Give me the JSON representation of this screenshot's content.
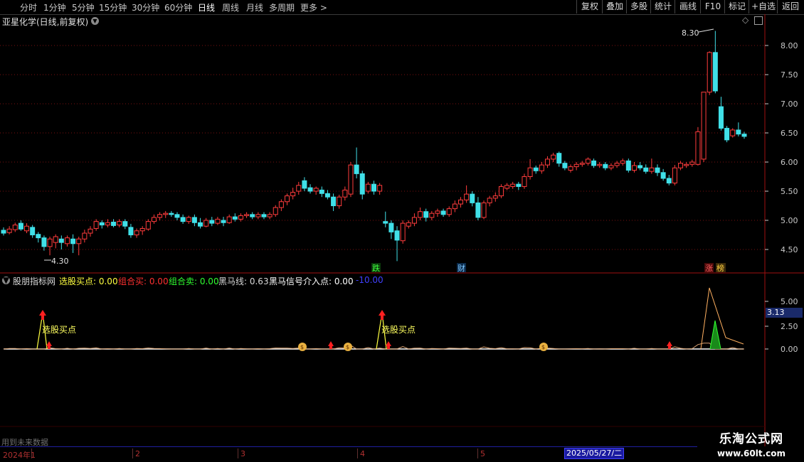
{
  "toolbar": {
    "periods": [
      "分时",
      "1分钟",
      "5分钟",
      "15分钟",
      "30分钟",
      "60分钟",
      "日线",
      "周线",
      "月线",
      "多周期",
      "更多 >"
    ],
    "active_period": "日线",
    "buttons": [
      "复权",
      "叠加",
      "多股",
      "统计",
      "画线",
      "F10",
      "标记",
      "+自选",
      "返回"
    ]
  },
  "chart_title": "亚星化学(日线,前复权)",
  "price_axis": {
    "ticks": [
      "8.00",
      "7.50",
      "7.00",
      "6.50",
      "6.00",
      "5.50",
      "5.00",
      "4.50"
    ]
  },
  "markers": {
    "high": "8.30",
    "low": "4.30"
  },
  "event_tags": [
    "跌",
    "财",
    "涨",
    "榜"
  ],
  "indicator": {
    "name": "股朋指标网",
    "items": [
      {
        "label": "选股买点: 0.00",
        "color": "#ffff40"
      },
      {
        "label": "组合买: 0.00",
        "color": "#ff3030"
      },
      {
        "label": "组合卖: 0.00",
        "color": "#30ff30"
      },
      {
        "label": "黑马线: 0.63",
        "color": "#d8d8d8"
      },
      {
        "label": "黑马信号介入点: 0.00",
        "color": "#ffffff"
      },
      {
        "label": "-10.00",
        "color": "#4040ff"
      }
    ],
    "axis_ticks": [
      "5.00",
      "2.50",
      "0.00"
    ],
    "current_value": "3.13",
    "signal_label": "选股买点"
  },
  "bottom_note": "用到未来数据",
  "timeline": {
    "labels": [
      "2024年1",
      "2",
      "3",
      "4",
      "5"
    ],
    "cursor_date": "2025/05/27/二"
  },
  "watermark": {
    "line1": "乐淘公式网",
    "line2": "www.60lt.com"
  },
  "colors": {
    "up": "#ff3c3c",
    "down": "#40e0e8",
    "grid": "#7a1010",
    "axis_text": "#c8c8c8"
  },
  "chart_data": {
    "type": "candlestick",
    "title": "亚星化学(日线,前复权)",
    "ylim": [
      4.2,
      8.3
    ],
    "y_ticks": [
      8.0,
      7.5,
      7.0,
      6.5,
      6.0,
      5.5,
      5.0,
      4.5
    ],
    "candles": [
      [
        4.83,
        4.78,
        4.88,
        4.74
      ],
      [
        4.79,
        4.85,
        4.9,
        4.76
      ],
      [
        4.84,
        4.92,
        4.96,
        4.8
      ],
      [
        4.95,
        4.85,
        5.0,
        4.82
      ],
      [
        4.82,
        4.9,
        4.95,
        4.78
      ],
      [
        4.88,
        4.75,
        4.92,
        4.7
      ],
      [
        4.76,
        4.7,
        4.8,
        4.62
      ],
      [
        4.7,
        4.55,
        4.74,
        4.48
      ],
      [
        4.55,
        4.68,
        4.72,
        4.4
      ],
      [
        4.62,
        4.72,
        4.76,
        4.52
      ],
      [
        4.68,
        4.62,
        4.74,
        4.5
      ],
      [
        4.6,
        4.7,
        4.74,
        4.55
      ],
      [
        4.68,
        4.6,
        4.76,
        4.44
      ],
      [
        4.6,
        4.68,
        4.72,
        4.4
      ],
      [
        4.68,
        4.78,
        4.84,
        4.62
      ],
      [
        4.78,
        4.85,
        4.9,
        4.72
      ],
      [
        4.86,
        4.98,
        5.02,
        4.82
      ],
      [
        4.96,
        4.92,
        5.0,
        4.86
      ],
      [
        4.92,
        4.96,
        5.02,
        4.88
      ],
      [
        4.97,
        4.91,
        5.02,
        4.88
      ],
      [
        4.92,
        4.98,
        5.02,
        4.88
      ],
      [
        4.98,
        4.9,
        5.02,
        4.85
      ],
      [
        4.88,
        4.75,
        4.94,
        4.7
      ],
      [
        4.75,
        4.82,
        4.86,
        4.7
      ],
      [
        4.82,
        4.86,
        4.9,
        4.75
      ],
      [
        4.85,
        4.98,
        5.02,
        4.82
      ],
      [
        4.98,
        5.05,
        5.1,
        4.94
      ],
      [
        5.05,
        5.1,
        5.14,
        5.0
      ],
      [
        5.1,
        5.12,
        5.16,
        5.04
      ],
      [
        5.12,
        5.1,
        5.16,
        5.06
      ],
      [
        5.1,
        5.05,
        5.14,
        5.0
      ],
      [
        5.05,
        4.98,
        5.1,
        4.94
      ],
      [
        4.98,
        5.05,
        5.08,
        4.94
      ],
      [
        5.05,
        4.96,
        5.1,
        4.9
      ],
      [
        4.96,
        4.9,
        5.04,
        4.86
      ],
      [
        4.9,
        5.0,
        5.04,
        4.88
      ],
      [
        5.0,
        4.95,
        5.06,
        4.9
      ],
      [
        4.95,
        5.02,
        5.06,
        4.92
      ],
      [
        5.0,
        4.96,
        5.06,
        4.9
      ],
      [
        4.96,
        5.06,
        5.1,
        4.94
      ],
      [
        5.06,
        5.02,
        5.12,
        4.98
      ],
      [
        5.02,
        5.08,
        5.12,
        4.98
      ],
      [
        5.08,
        5.1,
        5.14,
        5.04
      ],
      [
        5.1,
        5.06,
        5.14,
        5.02
      ],
      [
        5.06,
        5.1,
        5.14,
        5.02
      ],
      [
        5.1,
        5.06,
        5.14,
        5.02
      ],
      [
        5.06,
        5.1,
        5.14,
        5.02
      ],
      [
        5.1,
        5.22,
        5.26,
        5.06
      ],
      [
        5.22,
        5.32,
        5.36,
        5.16
      ],
      [
        5.32,
        5.42,
        5.46,
        5.26
      ],
      [
        5.42,
        5.48,
        5.56,
        5.36
      ],
      [
        5.5,
        5.6,
        5.66,
        5.44
      ],
      [
        5.68,
        5.55,
        5.74,
        5.5
      ],
      [
        5.56,
        5.5,
        5.62,
        5.46
      ],
      [
        5.5,
        5.55,
        5.58,
        5.44
      ],
      [
        5.52,
        5.46,
        5.58,
        5.4
      ],
      [
        5.46,
        5.4,
        5.52,
        5.36
      ],
      [
        5.4,
        5.25,
        5.46,
        5.16
      ],
      [
        5.25,
        5.4,
        5.44,
        5.2
      ],
      [
        5.4,
        5.52,
        5.58,
        5.34
      ],
      [
        5.45,
        5.95,
        6.0,
        5.4
      ],
      [
        5.95,
        5.8,
        6.25,
        5.72
      ],
      [
        5.8,
        5.45,
        5.85,
        5.36
      ],
      [
        5.5,
        5.62,
        5.66,
        5.46
      ],
      [
        5.62,
        5.5,
        5.68,
        5.44
      ],
      [
        5.5,
        5.6,
        5.64,
        5.44
      ],
      [
        4.98,
        4.95,
        5.15,
        4.88
      ],
      [
        4.95,
        4.8,
        5.0,
        4.68
      ],
      [
        4.82,
        4.66,
        4.9,
        4.3
      ],
      [
        4.65,
        4.95,
        5.0,
        4.6
      ],
      [
        4.9,
        4.96,
        5.0,
        4.86
      ],
      [
        4.95,
        5.05,
        5.12,
        4.9
      ],
      [
        5.05,
        5.15,
        5.22,
        5.0
      ],
      [
        5.15,
        5.05,
        5.2,
        4.98
      ],
      [
        5.05,
        5.12,
        5.16,
        5.0
      ],
      [
        5.12,
        5.16,
        5.2,
        5.06
      ],
      [
        5.16,
        5.1,
        5.2,
        5.06
      ],
      [
        5.1,
        5.2,
        5.24,
        5.06
      ],
      [
        5.2,
        5.28,
        5.34,
        5.14
      ],
      [
        5.28,
        5.35,
        5.4,
        5.22
      ],
      [
        5.35,
        5.45,
        5.6,
        5.3
      ],
      [
        5.45,
        5.3,
        5.5,
        5.24
      ],
      [
        5.3,
        5.05,
        5.4,
        5.0
      ],
      [
        5.05,
        5.3,
        5.34,
        5.02
      ],
      [
        5.3,
        5.38,
        5.42,
        5.24
      ],
      [
        5.38,
        5.42,
        5.48,
        5.32
      ],
      [
        5.42,
        5.58,
        5.62,
        5.38
      ],
      [
        5.55,
        5.6,
        5.64,
        5.52
      ],
      [
        5.58,
        5.62,
        5.66,
        5.54
      ],
      [
        5.62,
        5.58,
        5.66,
        5.52
      ],
      [
        5.58,
        5.75,
        5.8,
        5.54
      ],
      [
        5.75,
        5.9,
        6.05,
        5.7
      ],
      [
        5.9,
        5.85,
        5.94,
        5.8
      ],
      [
        5.85,
        5.95,
        6.0,
        5.8
      ],
      [
        5.95,
        6.05,
        6.1,
        5.9
      ],
      [
        6.05,
        6.12,
        6.16,
        6.0
      ],
      [
        6.15,
        5.98,
        6.18,
        5.92
      ],
      [
        5.98,
        5.9,
        6.02,
        5.86
      ],
      [
        5.86,
        5.92,
        5.96,
        5.82
      ],
      [
        5.92,
        5.96,
        6.0,
        5.86
      ],
      [
        5.96,
        5.98,
        6.02,
        5.92
      ],
      [
        5.98,
        6.05,
        6.08,
        5.94
      ],
      [
        6.02,
        5.94,
        6.06,
        5.9
      ],
      [
        5.94,
        5.96,
        6.0,
        5.9
      ],
      [
        5.96,
        5.9,
        6.0,
        5.86
      ],
      [
        5.9,
        5.94,
        5.98,
        5.86
      ],
      [
        5.94,
        5.98,
        6.02,
        5.9
      ],
      [
        5.98,
        6.02,
        6.06,
        5.94
      ],
      [
        6.02,
        5.86,
        6.06,
        5.82
      ],
      [
        5.86,
        5.94,
        6.0,
        5.82
      ],
      [
        5.94,
        5.9,
        6.0,
        5.86
      ],
      [
        5.9,
        5.84,
        5.96,
        5.8
      ],
      [
        5.84,
        5.9,
        6.06,
        5.8
      ],
      [
        5.9,
        5.82,
        5.96,
        5.76
      ],
      [
        5.82,
        5.72,
        5.88,
        5.68
      ],
      [
        5.72,
        5.64,
        5.78,
        5.6
      ],
      [
        5.64,
        5.9,
        5.95,
        5.6
      ],
      [
        5.9,
        5.98,
        6.02,
        5.86
      ],
      [
        5.94,
        5.96,
        6.0,
        5.9
      ],
      [
        5.96,
        6.0,
        6.04,
        5.92
      ],
      [
        5.96,
        6.52,
        6.6,
        5.94
      ],
      [
        6.05,
        7.2,
        7.2,
        6.0
      ],
      [
        7.2,
        7.88,
        7.9,
        7.15
      ],
      [
        7.88,
        7.22,
        8.25,
        7.18
      ],
      [
        6.95,
        6.58,
        7.12,
        6.54
      ],
      [
        6.58,
        6.38,
        6.62,
        6.34
      ],
      [
        6.45,
        6.55,
        6.58,
        6.42
      ],
      [
        6.55,
        6.48,
        6.68,
        6.44
      ],
      [
        6.48,
        6.44,
        6.52,
        6.4
      ]
    ]
  }
}
